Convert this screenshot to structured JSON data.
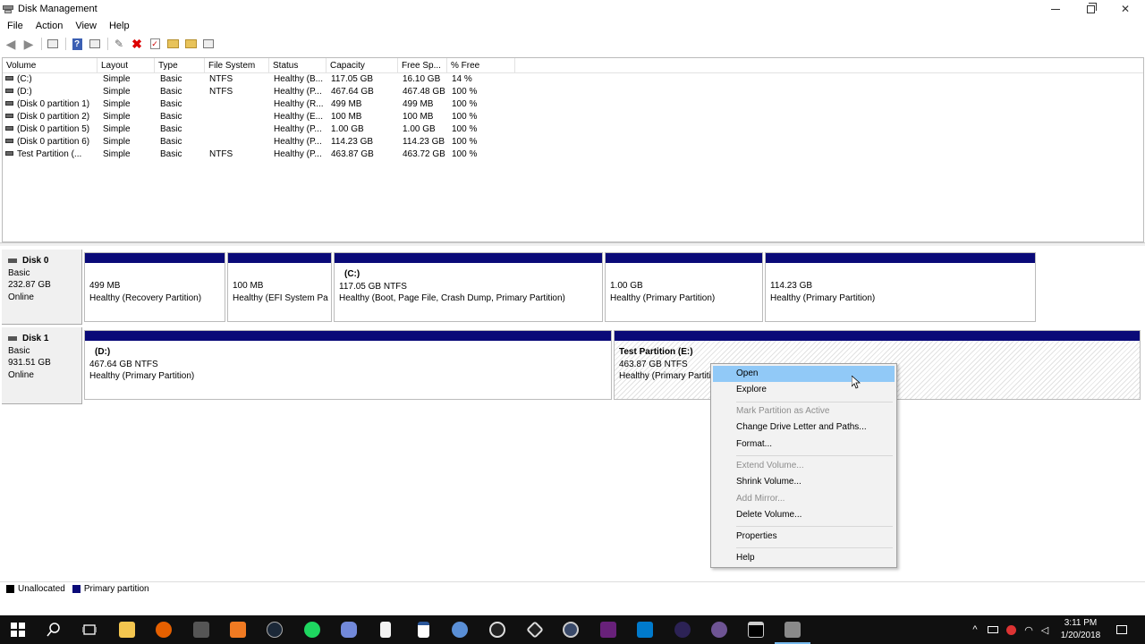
{
  "window": {
    "title": "Disk Management"
  },
  "menu": [
    "File",
    "Action",
    "View",
    "Help"
  ],
  "columns": [
    "Volume",
    "Layout",
    "Type",
    "File System",
    "Status",
    "Capacity",
    "Free Sp...",
    "% Free"
  ],
  "volumes": [
    {
      "volume": "(C:)",
      "layout": "Simple",
      "type": "Basic",
      "fs": "NTFS",
      "status": "Healthy (B...",
      "capacity": "117.05 GB",
      "free": "16.10 GB",
      "pct": "14 %"
    },
    {
      "volume": "(D:)",
      "layout": "Simple",
      "type": "Basic",
      "fs": "NTFS",
      "status": "Healthy (P...",
      "capacity": "467.64 GB",
      "free": "467.48 GB",
      "pct": "100 %"
    },
    {
      "volume": "(Disk 0 partition 1)",
      "layout": "Simple",
      "type": "Basic",
      "fs": "",
      "status": "Healthy (R...",
      "capacity": "499 MB",
      "free": "499 MB",
      "pct": "100 %"
    },
    {
      "volume": "(Disk 0 partition 2)",
      "layout": "Simple",
      "type": "Basic",
      "fs": "",
      "status": "Healthy (E...",
      "capacity": "100 MB",
      "free": "100 MB",
      "pct": "100 %"
    },
    {
      "volume": "(Disk 0 partition 5)",
      "layout": "Simple",
      "type": "Basic",
      "fs": "",
      "status": "Healthy (P...",
      "capacity": "1.00 GB",
      "free": "1.00 GB",
      "pct": "100 %"
    },
    {
      "volume": "(Disk 0 partition 6)",
      "layout": "Simple",
      "type": "Basic",
      "fs": "",
      "status": "Healthy (P...",
      "capacity": "114.23 GB",
      "free": "114.23 GB",
      "pct": "100 %"
    },
    {
      "volume": "Test Partition (...",
      "layout": "Simple",
      "type": "Basic",
      "fs": "NTFS",
      "status": "Healthy (P...",
      "capacity": "463.87 GB",
      "free": "463.72 GB",
      "pct": "100 %"
    }
  ],
  "disks": [
    {
      "name": "Disk 0",
      "type": "Basic",
      "size": "232.87 GB",
      "state": "Online",
      "partitions": [
        {
          "name": "",
          "size": "499 MB",
          "status": "Healthy (Recovery Partition)"
        },
        {
          "name": "",
          "size": "100 MB",
          "status": "Healthy (EFI System Part"
        },
        {
          "name": "(C:)",
          "size": "117.05 GB NTFS",
          "status": "Healthy (Boot, Page File, Crash Dump, Primary Partition)"
        },
        {
          "name": "",
          "size": "1.00 GB",
          "status": "Healthy (Primary Partition)"
        },
        {
          "name": "",
          "size": "114.23 GB",
          "status": "Healthy (Primary Partition)"
        }
      ]
    },
    {
      "name": "Disk 1",
      "type": "Basic",
      "size": "931.51 GB",
      "state": "Online",
      "partitions": [
        {
          "name": "(D:)",
          "size": "467.64 GB NTFS",
          "status": "Healthy (Primary Partition)"
        },
        {
          "name": "Test Partition  (E:)",
          "size": "463.87 GB NTFS",
          "status": "Healthy (Primary Partiti"
        }
      ]
    }
  ],
  "context_menu": [
    {
      "label": "Open",
      "enabled": true,
      "highlighted": true
    },
    {
      "label": "Explore",
      "enabled": true
    },
    {
      "label": "Mark Partition as Active",
      "enabled": false
    },
    {
      "label": "Change Drive Letter and Paths...",
      "enabled": true
    },
    {
      "label": "Format...",
      "enabled": true
    },
    {
      "label": "Extend Volume...",
      "enabled": false
    },
    {
      "label": "Shrink Volume...",
      "enabled": true
    },
    {
      "label": "Add Mirror...",
      "enabled": false
    },
    {
      "label": "Delete Volume...",
      "enabled": true
    },
    {
      "label": "Properties",
      "enabled": true
    },
    {
      "label": "Help",
      "enabled": true
    }
  ],
  "legend": [
    {
      "label": "Unallocated",
      "color": "#000000"
    },
    {
      "label": "Primary partition",
      "color": "#0a0a78"
    }
  ],
  "clock": {
    "time": "3:11 PM",
    "date": "1/20/2018"
  },
  "colors": {
    "partition_bar": "#0a0a78",
    "menu_highlight": "#91c9f7",
    "taskbar": "#101010"
  }
}
